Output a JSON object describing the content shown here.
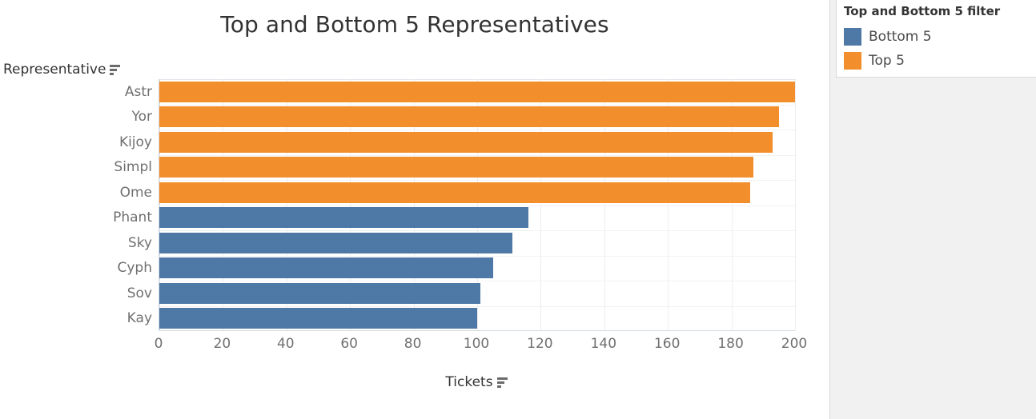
{
  "worksheet": {
    "title": "Top and Bottom 5 Representatives",
    "y_axis_caption": "Representative",
    "x_axis_caption": "Tickets",
    "sort_icon": "sort-descending-icon"
  },
  "legend": {
    "title": "Top and Bottom 5 filter",
    "items": [
      {
        "label": "Bottom 5",
        "color": "#4E79A7"
      },
      {
        "label": "Top 5",
        "color": "#F28E2B"
      }
    ]
  },
  "colors": {
    "top5": "#F28E2B",
    "bottom5": "#4E79A7",
    "gridline": "#ededed",
    "axis_text": "#707070",
    "title_text": "#333333",
    "panel_background": "#f1f1f1"
  },
  "chart_data": {
    "type": "bar",
    "orientation": "horizontal",
    "title": "Top and Bottom 5 Representatives",
    "xlabel": "Tickets",
    "ylabel": "Representative",
    "xlim": [
      0,
      200
    ],
    "xticks": [
      0,
      20,
      40,
      60,
      80,
      100,
      120,
      140,
      160,
      180,
      200
    ],
    "grid": true,
    "legend_position": "right",
    "categories": [
      "Astr",
      "Yor",
      "Kijoy",
      "Simpl",
      "Ome",
      "Phant",
      "Sky",
      "Cyph",
      "Sov",
      "Kay"
    ],
    "values": [
      200,
      195,
      193,
      187,
      186,
      116,
      111,
      105,
      101,
      100
    ],
    "groups": [
      "Top 5",
      "Top 5",
      "Top 5",
      "Top 5",
      "Top 5",
      "Bottom 5",
      "Bottom 5",
      "Bottom 5",
      "Bottom 5",
      "Bottom 5"
    ],
    "series": [
      {
        "name": "Top 5",
        "color": "#F28E2B",
        "categories": [
          "Astr",
          "Yor",
          "Kijoy",
          "Simpl",
          "Ome"
        ],
        "values": [
          200,
          195,
          193,
          187,
          186
        ]
      },
      {
        "name": "Bottom 5",
        "color": "#4E79A7",
        "categories": [
          "Phant",
          "Sky",
          "Cyph",
          "Sov",
          "Kay"
        ],
        "values": [
          116,
          111,
          105,
          101,
          100
        ]
      }
    ]
  }
}
